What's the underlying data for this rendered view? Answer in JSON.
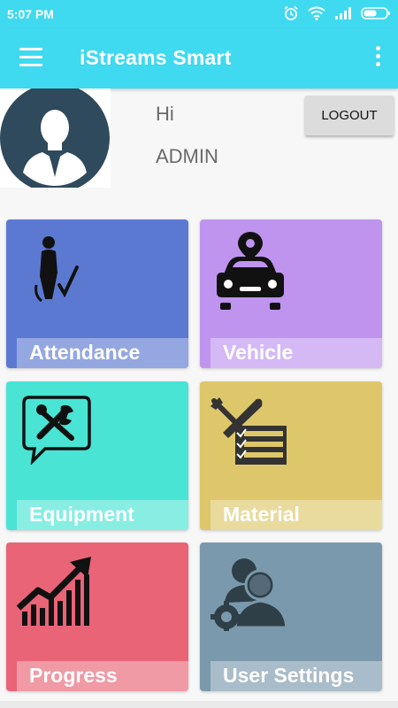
{
  "status_bar": {
    "time": "5:07 PM",
    "icons": [
      "alarm-icon",
      "wifi-icon",
      "signal-icon",
      "battery-icon"
    ]
  },
  "app_bar": {
    "title": "iStreams Smart",
    "menu_icon": "hamburger-menu-icon",
    "overflow_icon": "more-vertical-icon",
    "color": "#3fd9f0"
  },
  "profile": {
    "greeting": "Hi",
    "username": "ADMIN",
    "logout_label": "LOGOUT",
    "avatar_icon": "user-avatar-icon"
  },
  "tiles": [
    {
      "label": "Attendance",
      "icon": "attendance-icon",
      "color": "#5c79d2"
    },
    {
      "label": "Vehicle",
      "icon": "vehicle-icon",
      "color": "#bf94ee"
    },
    {
      "label": "Equipment",
      "icon": "equipment-icon",
      "color": "#49e4d4"
    },
    {
      "label": "Material",
      "icon": "material-icon",
      "color": "#ddc76a"
    },
    {
      "label": "Progress",
      "icon": "progress-icon",
      "color": "#e96477"
    },
    {
      "label": "User Settings",
      "icon": "user-settings-icon",
      "color": "#7b99ac"
    }
  ]
}
